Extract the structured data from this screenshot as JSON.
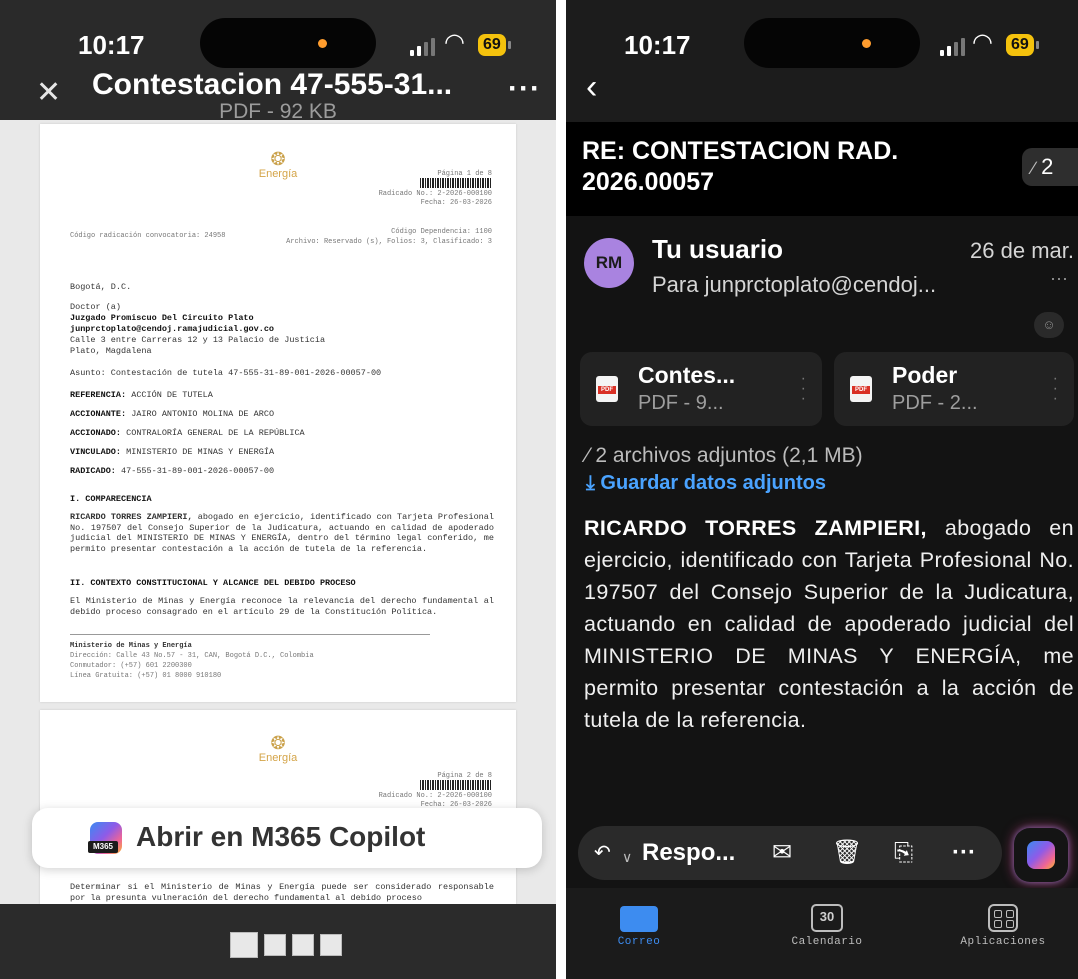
{
  "left_phone": {
    "status": {
      "time": "10:17",
      "battery": "69"
    },
    "header": {
      "title": "Contestacion 47-555-31...",
      "subtitle": "PDF - 92 KB"
    },
    "page1": {
      "logo_text": "Energía",
      "page_label": "Página 1 de 8",
      "radicado": "Radicado No.: 2-2026-000100",
      "fecha": "Fecha: 26-03-2026",
      "code_left": "Código radicación convocatoria: 24958",
      "code_right": "Código Dependencia: 1100",
      "archive": "Archivo: Reservado (s), Folios: 3, Clasificado: 3",
      "city": "Bogotá, D.C.",
      "salutation": "Doctor (a)",
      "court": "Juzgado Promiscuo Del Circuito Plato",
      "email": "junprctoplato@cendoj.ramajudicial.gov.co",
      "address": "Calle 3 entre Carreras 12 y 13 Palacio de Justicia",
      "place": "Plato, Magdalena",
      "asunto": "Asunto: Contestación de tutela 47-555-31-89-001-2026-00057-00",
      "referencia_label": "REFERENCIA:",
      "referencia": "ACCIÓN DE TUTELA",
      "accionante_label": "ACCIONANTE:",
      "accionante": "JAIRO ANTONIO MOLINA DE ARCO",
      "accionado_label": "ACCIONADO:",
      "accionado": "CONTRALORÍA GENERAL DE LA REPÚBLICA",
      "vinculado_label": "VINCULADO:",
      "vinculado": "MINISTERIO DE MINAS Y ENERGÍA",
      "radicado_label": "RADICADO:",
      "radicado_no": "47-555-31-89-001-2026-00057-00",
      "section1": "I. COMPARECENCIA",
      "section1_lead": "RICARDO TORRES ZAMPIERI,",
      "section1_text": "abogado en ejercicio, identificado con Tarjeta Profesional No. 197507 del Consejo Superior de la Judicatura, actuando en calidad de apoderado judicial del MINISTERIO DE MINAS Y ENERGÍA, dentro del término legal conferido, me permito presentar contestación a la acción de tutela de la referencia.",
      "section2": "II. CONTEXTO CONSTITUCIONAL Y ALCANCE DEL DEBIDO PROCESO",
      "section2_text": "El Ministerio de Minas y Energía reconoce la relevancia del derecho fundamental al debido proceso consagrado en el artículo 29 de la Constitución Política.",
      "footer_org": "Ministerio de Minas y Energía",
      "footer_address": "Dirección: Calle 43 No.57 - 31, CAN, Bogotá D.C., Colombia",
      "footer_phone": "Conmutador: (+57) 601 2200300",
      "footer_line": "Línea Gratuita: (+57) 01 8000 910180"
    },
    "page2": {
      "logo_text": "Energía",
      "page_label": "Página 2 de 8",
      "radicado": "Radicado No.: 2-2026-000100",
      "fecha": "Fecha: 26-03-2026",
      "text": "Determinar si el Ministerio de Minas y Energía puede ser considerado responsable por la presunta vulneración del derecho fundamental al debido proceso"
    },
    "copilot_button": {
      "label": "Abrir en M365 Copilot",
      "badge": "M365"
    },
    "thumbnails": [
      "page-1",
      "page-2",
      "page-3",
      "page-4"
    ]
  },
  "right_phone": {
    "status": {
      "time": "10:17",
      "battery": "69"
    },
    "subject": "RE: CONTESTACION RAD. 2026.00057",
    "attachment_badge": "2",
    "message": {
      "avatar_initials": "RM",
      "sender": "Tu usuario",
      "date": "26 de mar.",
      "to": "Para junprctoplato@cendoj...",
      "to_more": "···",
      "reaction_icon": "smiley-icon"
    },
    "attachments": [
      {
        "name": "Contes...",
        "size": "PDF - 9..."
      },
      {
        "name": "Poder",
        "size": "PDF - 2..."
      }
    ],
    "attachments_summary": "2 archivos adjuntos (2,1 MB)",
    "save_attachments": "Guardar datos adjuntos",
    "body_lead": "RICARDO TORRES ZAMPIERI,",
    "body_text": " abogado en ejercicio, identificado con Tarjeta Profesional No. 197507 del Consejo Superior de la Judicatura, actuando en calidad de apoderado judicial del MINISTERIO DE MINAS Y ENERGÍA, me permito presentar contestación a la acción de tutela de la referencia.",
    "action_bar": {
      "reply_label": "Respo..."
    },
    "tabs": [
      {
        "label": "Correo",
        "active": true
      },
      {
        "label": "Calendario",
        "date": "30"
      },
      {
        "label": "Aplicaciones"
      }
    ],
    "colors": {
      "accent": "#4aa3ff",
      "avatar": "#a983e0",
      "battery": "#f4c20d"
    }
  }
}
